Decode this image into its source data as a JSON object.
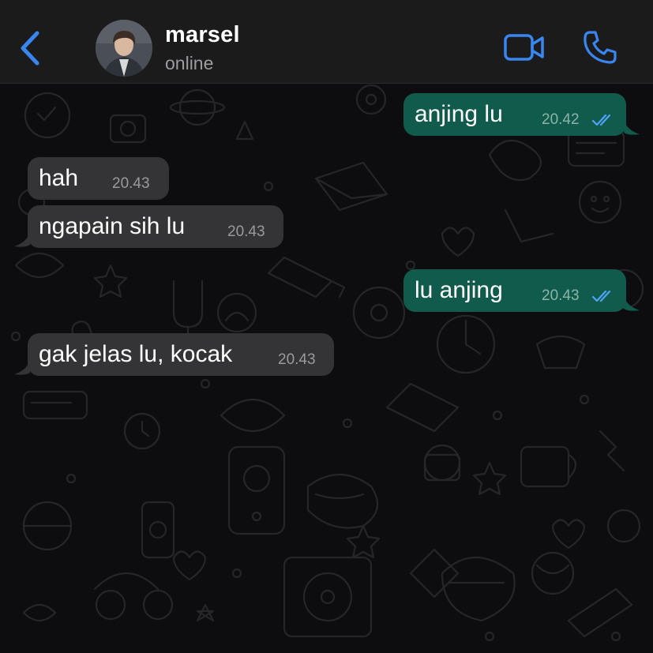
{
  "header": {
    "contact_name": "marsel",
    "status": "online",
    "back_icon": "chevron-left-icon",
    "video_icon": "video-camera-icon",
    "call_icon": "phone-icon",
    "accent_color": "#3a86f0"
  },
  "messages": [
    {
      "direction": "outgoing",
      "text": "anjing lu",
      "time": "20.42",
      "status_icon": "double-check-icon",
      "read": true
    },
    {
      "direction": "incoming",
      "text": "hah",
      "time": "20.43"
    },
    {
      "direction": "incoming",
      "text": "ngapain sih lu",
      "time": "20.43"
    },
    {
      "direction": "outgoing",
      "text": "lu anjing",
      "time": "20.43",
      "status_icon": "double-check-icon",
      "read": true
    },
    {
      "direction": "incoming",
      "text": "gak jelas lu, kocak",
      "time": "20.43"
    }
  ],
  "colors": {
    "outgoing_bubble": "#115b4c",
    "incoming_bubble": "#343436",
    "read_check": "#4fa3f7",
    "header_bg": "#1b1b1c"
  }
}
